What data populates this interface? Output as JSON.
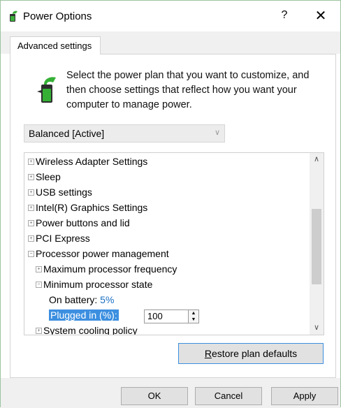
{
  "window": {
    "title": "Power Options",
    "help_glyph": "?",
    "close_glyph": "✕"
  },
  "tab": {
    "label": "Advanced settings"
  },
  "description": "Select the power plan that you want to customize, and then choose settings that reflect how you want your computer to manage power.",
  "plan_select": {
    "value": "Balanced [Active]"
  },
  "tree": {
    "items": [
      {
        "label": "Wireless Adapter Settings",
        "expanded": false
      },
      {
        "label": "Sleep",
        "expanded": false
      },
      {
        "label": "USB settings",
        "expanded": false
      },
      {
        "label": "Intel(R) Graphics Settings",
        "expanded": false
      },
      {
        "label": "Power buttons and lid",
        "expanded": false
      },
      {
        "label": "PCI Express",
        "expanded": false
      },
      {
        "label": "Processor power management",
        "expanded": true
      },
      {
        "label": "Maximum processor frequency",
        "expanded": false
      },
      {
        "label": "Minimum processor state",
        "expanded": true
      },
      {
        "label": "System cooling policy",
        "expanded": false
      }
    ],
    "on_battery": {
      "label": "On battery:",
      "value": "5%"
    },
    "plugged_in": {
      "label": "Plugged in (%):",
      "value": "100"
    }
  },
  "buttons": {
    "restore_prefix": "R",
    "restore_rest": "estore plan defaults",
    "ok": "OK",
    "cancel": "Cancel",
    "apply": "Apply"
  },
  "colors": {
    "selection": "#3c8fe0",
    "link_value": "#1a6fc4",
    "border_accent": "#9cc3a0"
  }
}
